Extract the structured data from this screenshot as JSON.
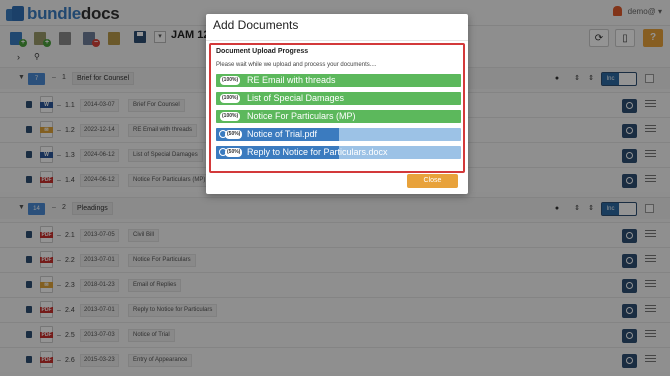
{
  "header": {
    "logo_text_a": "bundle",
    "logo_text_b": "docs",
    "user_label": "demo@ ▾"
  },
  "toolbar": {
    "bundle_title": "JAM 12/3|I",
    "select_glyph": "▾",
    "refresh_glyph": "⟳",
    "columns_glyph": "▯",
    "help_glyph": "?"
  },
  "sections": [
    {
      "num": "1",
      "count": "7",
      "title": "Brief for Counsel",
      "inc_label": "Inc",
      "docs": [
        {
          "num": "1.1",
          "date": "2014-03-07",
          "title": "Brief For Counsel",
          "type": "word",
          "type_label": "W"
        },
        {
          "num": "1.2",
          "date": "2022-12-14",
          "title": "RE Email with threads",
          "type": "email",
          "type_label": "✉"
        },
        {
          "num": "1.3",
          "date": "2024-06-12",
          "title": "List of Special Damages",
          "type": "word",
          "type_label": "W"
        },
        {
          "num": "1.4",
          "date": "2024-06-12",
          "title": "Notice For Particulars (MP)",
          "type": "pdf",
          "type_label": "PDF"
        }
      ]
    },
    {
      "num": "2",
      "count": "14",
      "title": "Pleadings",
      "inc_label": "Inc",
      "docs": [
        {
          "num": "2.1",
          "date": "2013-07-05",
          "title": "Civil Bill",
          "type": "pdf",
          "type_label": "PDF"
        },
        {
          "num": "2.2",
          "date": "2013-07-01",
          "title": "Notice For Particulars",
          "type": "pdf",
          "type_label": "PDF"
        },
        {
          "num": "2.3",
          "date": "2018-01-23",
          "title": "Email of Replies",
          "type": "email",
          "type_label": "✉"
        },
        {
          "num": "2.4",
          "date": "2013-07-01",
          "title": "Reply to Notice for Particulars",
          "type": "pdf",
          "type_label": "PDF"
        },
        {
          "num": "2.5",
          "date": "2013-07-03",
          "title": "Notice of Trial",
          "type": "pdf",
          "type_label": "PDF"
        },
        {
          "num": "2.6",
          "date": "2015-03-23",
          "title": "Entry of Appearance",
          "type": "pdf",
          "type_label": "PDF"
        }
      ]
    }
  ],
  "modal": {
    "title": "Add Documents",
    "progress_heading": "Document Upload Progress",
    "progress_message": "Please wait while we upload and process your documents....",
    "uploads": [
      {
        "name": "RE Email with threads",
        "percent": 100,
        "percent_label": "(100%)"
      },
      {
        "name": "List of Special Damages",
        "percent": 100,
        "percent_label": "(100%)"
      },
      {
        "name": "Notice For Particulars (MP)",
        "percent": 100,
        "percent_label": "(100%)"
      },
      {
        "name": "Notice of Trial.pdf",
        "percent": 50,
        "percent_label": "(50%)"
      },
      {
        "name": "Reply to Notice for Particulars.docx",
        "percent": 50,
        "percent_label": "(50%)"
      }
    ],
    "close_label": "Close"
  }
}
